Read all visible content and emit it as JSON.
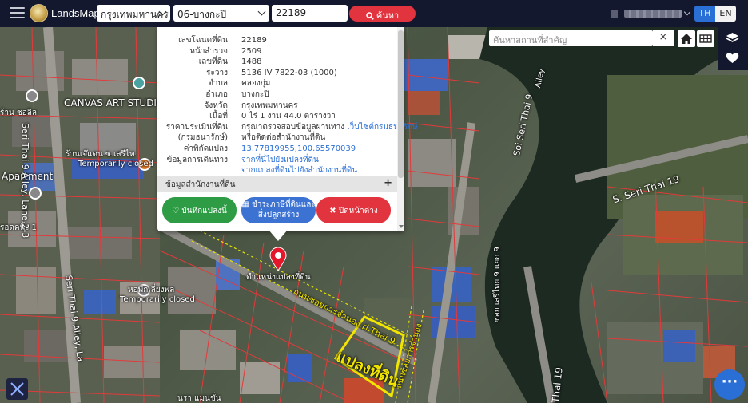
{
  "header": {
    "brand": "LandsMaps",
    "province": "กรุงเทพมหานคร",
    "district": "06-บางกะปิ",
    "parcel_no": "22189",
    "search_label": "ค้นหา",
    "lang_th": "TH",
    "lang_en": "EN"
  },
  "map_tools": {
    "place_search_placeholder": "ค้นหาสถานที่สำคัญ",
    "clear": "×"
  },
  "popup": {
    "rows": [
      {
        "label": "เลขโฉนดที่ดิน",
        "value": "22189"
      },
      {
        "label": "หน้าสำรวจ",
        "value": "2509"
      },
      {
        "label": "เลขที่ดิน",
        "value": "1488"
      },
      {
        "label": "ระวาง",
        "value": "5136 IV 7822-03 (1000)"
      },
      {
        "label": "ตำบล",
        "value": "คลองกุ่ม"
      },
      {
        "label": "อำเภอ",
        "value": "บางกะปิ"
      },
      {
        "label": "จังหวัด",
        "value": "กรุงเทพมหานคร"
      },
      {
        "label": "เนื้อที่",
        "value": "0 ไร่ 1 งาน 44.0 ตารางวา"
      }
    ],
    "price_label_1": "ราคาประเมินที่ดิน",
    "price_label_2": "(กรมธนารักษ์)",
    "price_value_1": "กรุณาตรวจสอบข้อมูลผ่านทาง",
    "price_link": "เว็บไซต์กรมธนารักษ์",
    "price_value_2": "หรือติดต่อสำนักงานที่ดิน",
    "coords_label": "ค่าพิกัดแปลง",
    "coords_value": "13.77819955,100.65570039",
    "route_label": "ข้อมูลการเดินทาง",
    "route_link_1": "จากที่นี่ไปยังแปลงที่ดิน",
    "route_link_2": "จากแปลงที่ดินไปยังสำนักงานที่ดิน",
    "office_bar": "ข้อมูลสำนักงานที่ดิน",
    "office_plus": "+",
    "btn_save": "บันทึกแปลงนี้",
    "btn_pay_1": "ชำระภาษีที่ดินและ",
    "btn_pay_2": "สิ่งปลูกสร้าง",
    "btn_close": "ปิดหน้าต่าง"
  },
  "map_labels": {
    "canvas": "CANVAS ART STUDIO",
    "apartment": "Apartment",
    "temp1": "Temporarily closed",
    "temp2": "Temporarily closed",
    "seri_alley_lane": "Seri Thai 9 Alley, Lane 2-3",
    "seri_alley_la": "Seri Thai 9 Alley, La",
    "soi_seri": "Soi Seri Thai 9",
    "s_seri": "S. Seri Thai 19",
    "alley": "Alley",
    "thai19": "Thai 19",
    "parcel_pos": "ตำแหน่งแปลงที่ดิน",
    "road_label": "ถนนซอยการจำนอง ri Thai 9",
    "road_label2": "ถนนซอยการจำนอง",
    "parcel_big": "แปลงที่ดิน",
    "hor": "หอพักเลี่ยงพล",
    "shop": "ร้านเจ๊แดน ซ.เสรีไท",
    "bottom": "นรา แมนชั่น",
    "left_top": "ร้าน ชอลิล",
    "seri_vert": "ซอย เสรีไทย 9 แยก 9",
    "left_mid": "รอดคนิ้ง 1"
  },
  "fab": "···",
  "colors": {
    "topbar": "#14182e",
    "search_btn": "#e1343f",
    "save_btn": "#2e9b45",
    "pay_btn": "#3c73d3",
    "close_btn": "#e1343f",
    "lang_active": "#2a6fd6",
    "parcel_lines": "#e23a3a",
    "highlight_parcel": "#f2e600"
  }
}
